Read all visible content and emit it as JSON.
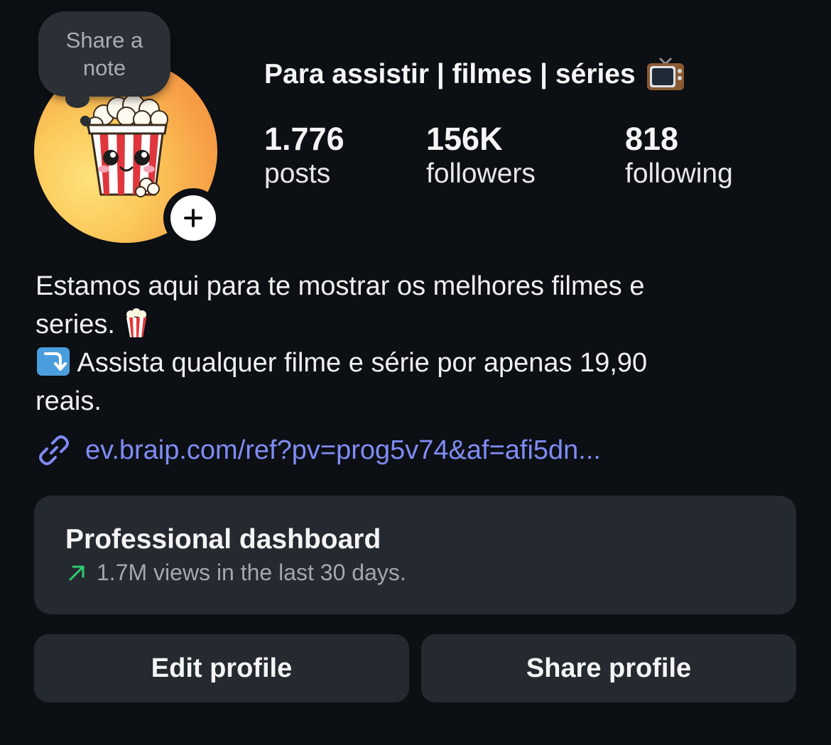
{
  "note": {
    "label": "Share a note"
  },
  "profile": {
    "name": "Para assistir | filmes | séries",
    "name_emoji": "tv-icon"
  },
  "stats": {
    "posts": {
      "value": "1.776",
      "label": "posts"
    },
    "followers": {
      "value": "156K",
      "label": "followers"
    },
    "following": {
      "value": "818",
      "label": "following"
    }
  },
  "bio": {
    "line1": "Estamos aqui para te mostrar os melhores filmes e",
    "line2": "series.",
    "line3": "Assista qualquer filme e série por apenas 19,90",
    "line4": "reais."
  },
  "link": {
    "text": "ev.braip.com/ref?pv=prog5v74&af=afi5dn..."
  },
  "dashboard": {
    "title": "Professional dashboard",
    "subtitle": "1.7M views in the last 30 days."
  },
  "buttons": {
    "edit": "Edit profile",
    "share": "Share profile"
  },
  "colors": {
    "background": "#0c0f14",
    "card": "#252930",
    "link": "#7f8cf4",
    "trend_green": "#2ecc71"
  }
}
